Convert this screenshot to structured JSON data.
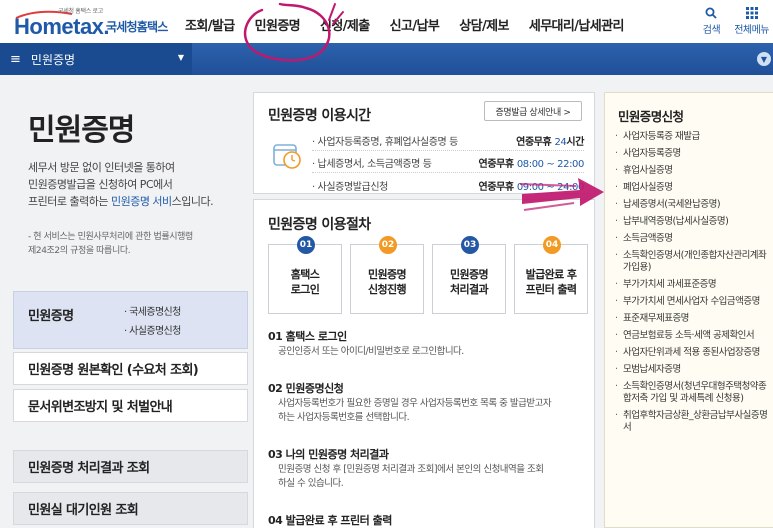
{
  "header": {
    "logo_small": "국세청 홈택스 로고",
    "logo_main": "Hometax.",
    "logo_kr": "국세청홈택스",
    "nav": [
      "조회/발급",
      "민원증명",
      "신청/제출",
      "신고/납부",
      "상담/제보",
      "세무대리/납세관리"
    ],
    "search_label": "검색",
    "allmenu_label": "전체메뉴"
  },
  "menubar": {
    "current": "민원증명"
  },
  "left": {
    "title": "민원증명",
    "intro_1": "세무서 방문 없이 인터넷을 통하여",
    "intro_2": "민원증명발급을 신청하여 PC에서",
    "intro_3a": "프린터로 출력하는 ",
    "intro_3b": "민원증명 서비",
    "intro_3c": "스입니다.",
    "note_1": "- 현 서비스는 민원사무처리에 관한 법률시행령",
    "note_2": "  제24조2의 규정을 따릅니다.",
    "nav_first_title": "민원증명",
    "nav_first_subs": [
      "· 국세증명신청",
      "· 사실증명신청"
    ],
    "nav_rows": [
      "민원증명 원본확인 (수요처 조회)",
      "문서위변조방지 및 처벌안내",
      "민원증명 처리결과 조회",
      "민원실 대기인원 조회"
    ]
  },
  "time_card": {
    "title": "민원증명 이용시간",
    "detail_button": "증명발급 상세안내 >",
    "rows": [
      {
        "label": "· 사업자등록증명, 휴폐업사실증명 등",
        "val_a": "연중무휴 ",
        "val_b": "24",
        "val_c": "시간"
      },
      {
        "label": "· 납세증명서, 소득금액증명 등",
        "val_a": "연중무휴 ",
        "val_b": "08:00 ~ 22:00",
        "val_c": ""
      },
      {
        "label": "· 사실증명발급신청",
        "val_a": "연중무휴 ",
        "val_b": "09:00 ~ 24:00",
        "val_c": ""
      }
    ]
  },
  "proc_card": {
    "title": "민원증명 이용절차",
    "steps": [
      {
        "num": "01",
        "l1": "홈택스",
        "l2": "로그인"
      },
      {
        "num": "02",
        "l1": "민원증명",
        "l2": "신청진행"
      },
      {
        "num": "03",
        "l1": "민원증명",
        "l2": "처리결과"
      },
      {
        "num": "04",
        "l1": "발급완료 후",
        "l2": "프린터 출력"
      }
    ],
    "s1_h": "01 홈택스 로그인",
    "s1_d": "공인인증서 또는 아이디/비밀번호로 로그인합니다.",
    "s2_h": "02 민원증명신청",
    "s2_d1": "사업자등록번호가 필요한 증명일 경우 사업자등록번호 목록 중 발급받고자",
    "s2_d2": "하는 사업자등록번호를 선택합니다.",
    "s3_h": "03 나의 민원증명 처리결과",
    "s3_d1": "민원증명 신청 후 [민원증명 처리결과 조회]에서 본인의 신청내역을 조회",
    "s3_d2": "하실 수 있습니다.",
    "s4_h": "04 발급완료 후 프린터 출력"
  },
  "right": {
    "title": "민원증명신청",
    "items": [
      "사업자등록증 재발급",
      "사업자등록증명",
      "휴업사실증명",
      "폐업사실증명",
      "납세증명서(국세완납증명)",
      "납부내역증명(납세사실증명)",
      "소득금액증명",
      "소득확인증명서(개인종합자산관리계좌 가입용)",
      "부가가치세 과세표준증명",
      "부가가치세 면세사업자 수입금액증명",
      "표준재무제표증명",
      "연금보험료등 소득·세액 공제확인서",
      "사업자단위과세 적용 종된사업장증명",
      "모범납세자증명",
      "소득확인증명서(청년우대형주택청약종합저축 가입 및 과세특례 신청용)",
      "취업후학자금상환_상환금납부사실증명서"
    ]
  },
  "colors": {
    "brand": "#1f5aa8",
    "accent_orange": "#f29a23",
    "annotation": "#c0186e"
  }
}
